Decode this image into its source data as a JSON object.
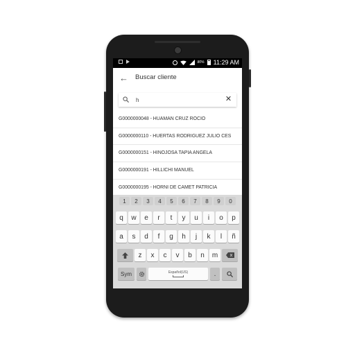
{
  "status_bar": {
    "battery_percent": "80%",
    "time": "11:29 AM"
  },
  "app_bar": {
    "title": "Buscar cliente"
  },
  "search": {
    "value": "h"
  },
  "results": [
    "G0000000048 - HUAMAN CRUZ ROCIO",
    "G0000000110 - HUERTAS RODRIGUEZ JULIO CES",
    "G0000000151 - HINOJOSA TAPIA ANGELA",
    "G0000000191 - HILLICHI MANUEL",
    "G0000000195 - HORNI DE CAMET PATRICIA"
  ],
  "keyboard": {
    "number_row": [
      "1",
      "2",
      "3",
      "4",
      "5",
      "6",
      "7",
      "8",
      "9",
      "0"
    ],
    "row1": [
      "q",
      "w",
      "e",
      "r",
      "t",
      "y",
      "u",
      "i",
      "o",
      "p"
    ],
    "row2": [
      "a",
      "s",
      "d",
      "f",
      "g",
      "h",
      "j",
      "k",
      "l",
      "ñ"
    ],
    "row3": [
      "z",
      "x",
      "c",
      "v",
      "b",
      "n",
      "m"
    ],
    "symbols_label": "Sym",
    "space_language": "Español(US)",
    "period": "."
  },
  "icons": {
    "back": "arrow-left-icon",
    "search": "search-icon",
    "clear": "close-icon",
    "shift": "shift-icon",
    "backspace": "backspace-icon",
    "settings": "gear-icon",
    "keyboard_search": "search-icon"
  }
}
